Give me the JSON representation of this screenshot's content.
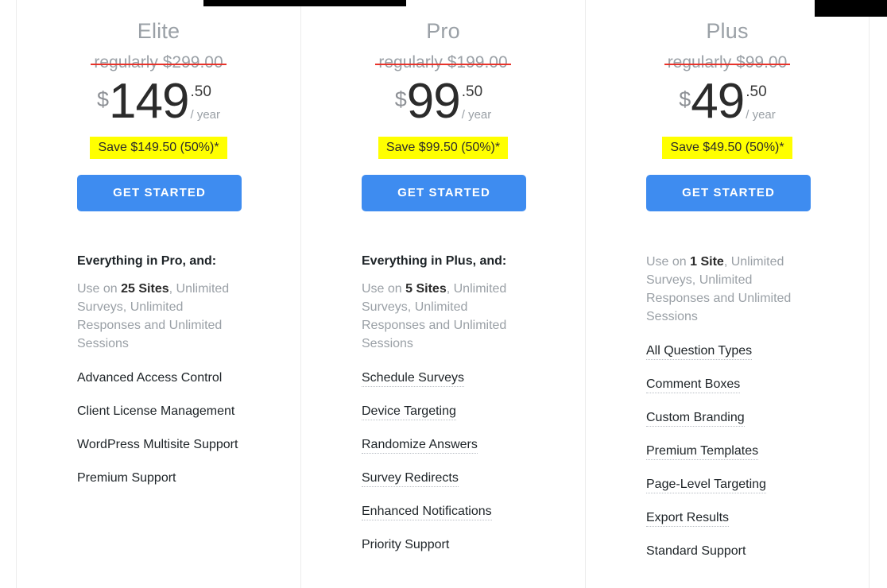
{
  "theme": {
    "accent_blue": "#3e8cf0",
    "badge_yellow": "#ffff00",
    "strike_red": "#e8332a",
    "muted_gray": "#9aa0a6",
    "text_dark": "#1d2327",
    "divider": "#ececec"
  },
  "plans": [
    {
      "name": "Elite",
      "regular_price_label": "regularly $299.00",
      "currency_symbol": "$",
      "amount": "149",
      "cents": ".50",
      "period": "/ year",
      "save_badge": "Save $149.50 (50%)*",
      "cta_label": "GET STARTED",
      "features_heading": "Everything in Pro, and:",
      "summary_prefix": "Use on ",
      "summary_highlight": "25 Sites",
      "summary_suffix": ", Unlimited Surveys, Unlimited Responses and Unlimited Sessions",
      "features": [
        {
          "label": "Advanced Access Control",
          "tooltip": false
        },
        {
          "label": "Client License Management",
          "tooltip": false
        },
        {
          "label": "WordPress Multisite Support",
          "tooltip": false
        },
        {
          "label": "Premium Support",
          "tooltip": false
        }
      ]
    },
    {
      "name": "Pro",
      "regular_price_label": "regularly $199.00",
      "currency_symbol": "$",
      "amount": "99",
      "cents": ".50",
      "period": "/ year",
      "save_badge": "Save $99.50 (50%)*",
      "cta_label": "GET STARTED",
      "features_heading": "Everything in Plus, and:",
      "summary_prefix": "Use on ",
      "summary_highlight": "5 Sites",
      "summary_suffix": ", Unlimited Surveys, Unlimited Responses and Unlimited Sessions",
      "features": [
        {
          "label": "Schedule Surveys",
          "tooltip": true
        },
        {
          "label": "Device Targeting",
          "tooltip": true
        },
        {
          "label": "Randomize Answers",
          "tooltip": true
        },
        {
          "label": "Survey Redirects",
          "tooltip": true
        },
        {
          "label": "Enhanced Notifications",
          "tooltip": true
        },
        {
          "label": "Priority Support",
          "tooltip": false
        }
      ]
    },
    {
      "name": "Plus",
      "regular_price_label": "regularly $99.00",
      "currency_symbol": "$",
      "amount": "49",
      "cents": ".50",
      "period": "/ year",
      "save_badge": "Save $49.50 (50%)*",
      "cta_label": "GET STARTED",
      "features_heading": "",
      "summary_prefix": "Use on ",
      "summary_highlight": "1 Site",
      "summary_suffix": ", Unlimited Surveys, Unlimited Responses and Unlimited Sessions",
      "features": [
        {
          "label": "All Question Types",
          "tooltip": true
        },
        {
          "label": "Comment Boxes",
          "tooltip": true
        },
        {
          "label": "Custom Branding",
          "tooltip": true
        },
        {
          "label": "Premium Templates",
          "tooltip": true
        },
        {
          "label": "Page-Level Targeting",
          "tooltip": true
        },
        {
          "label": "Export Results",
          "tooltip": true
        },
        {
          "label": "Standard Support",
          "tooltip": false
        }
      ]
    }
  ]
}
